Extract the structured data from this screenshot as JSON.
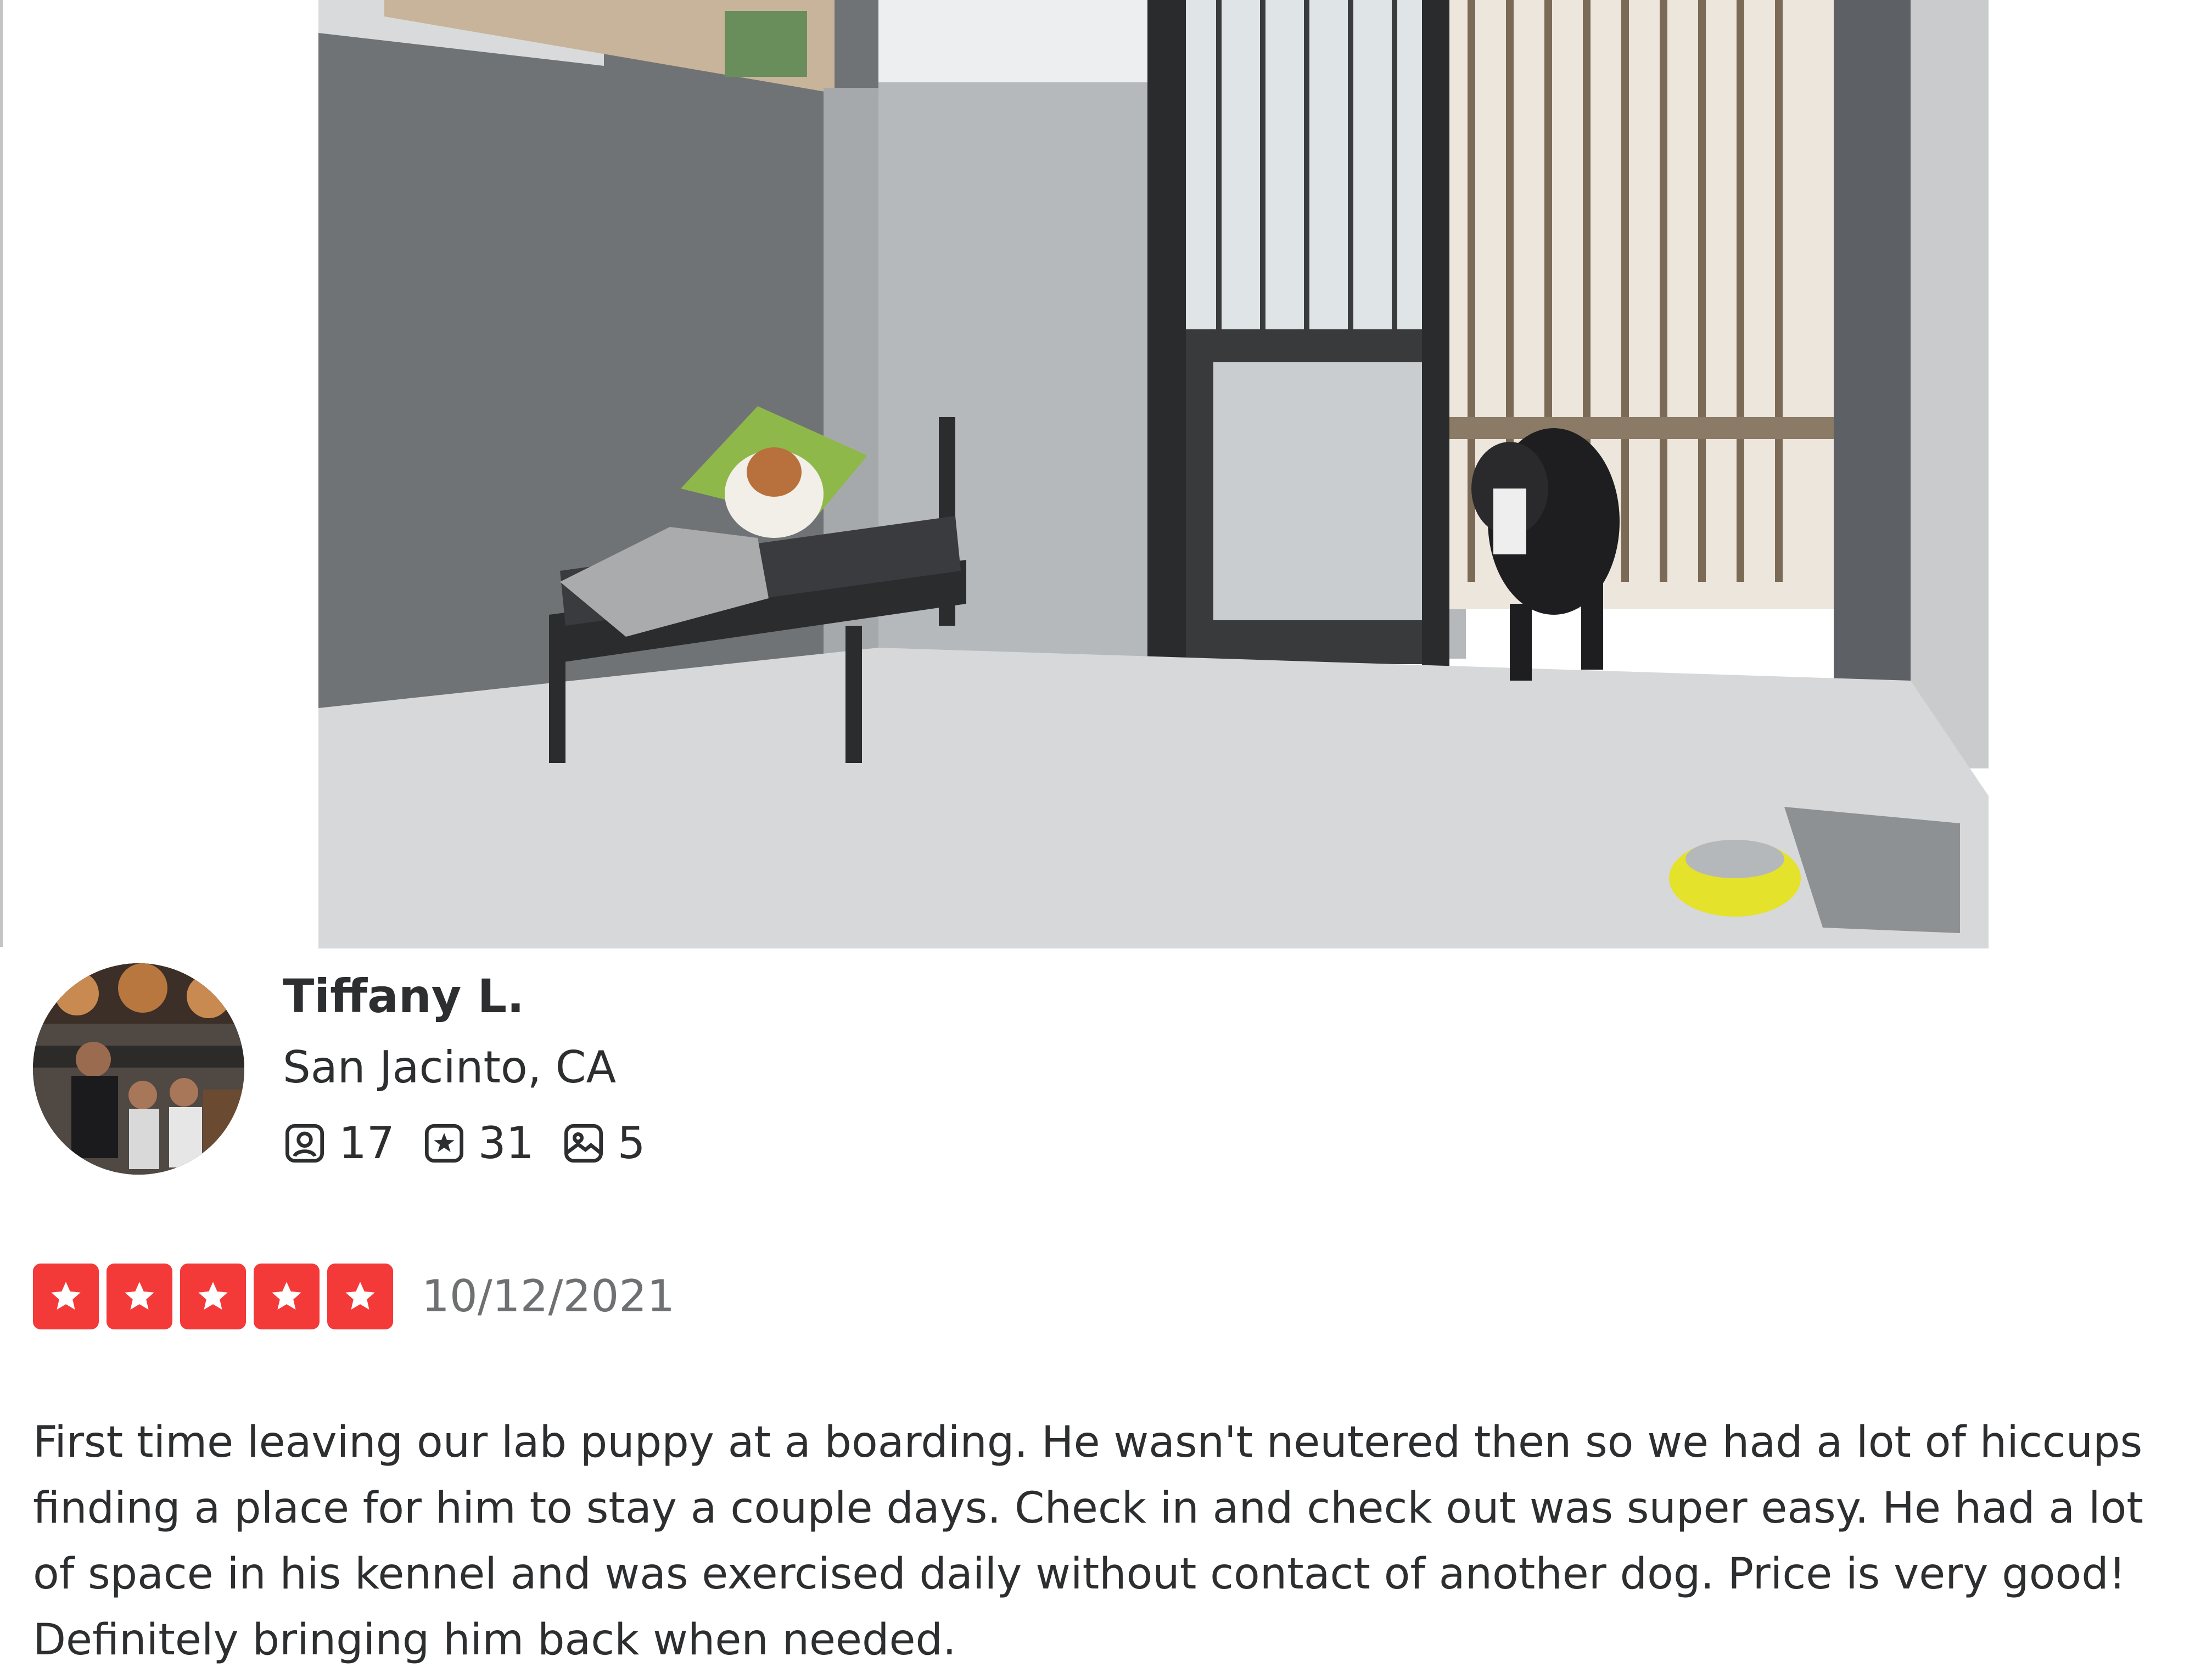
{
  "review": {
    "user": {
      "name": "Tiffany L.",
      "location": "San Jacinto, CA",
      "stats": [
        {
          "icon": "friends-icon",
          "count": "17"
        },
        {
          "icon": "reviews-star-icon",
          "count": "31"
        },
        {
          "icon": "photos-icon",
          "count": "5"
        }
      ]
    },
    "rating": {
      "stars": 5,
      "max": 5,
      "color": "#f43939"
    },
    "date": "10/12/2021",
    "text": "First time leaving our lab puppy at a boarding. He wasn't neutered then so we had a lot of hiccups finding a place for him to stay a couple days. Check in and check out was super easy. He had a lot of space in his kennel and was exercised daily without contact of another dog. Price is very good! Definitely bringing him back when needed."
  }
}
